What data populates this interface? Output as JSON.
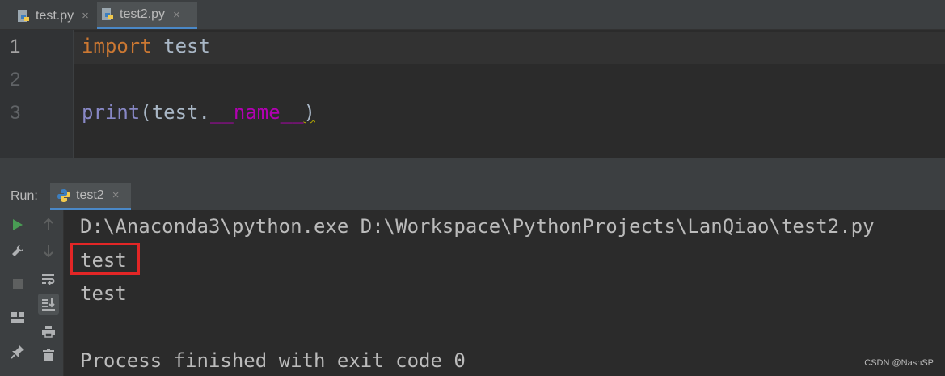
{
  "editor_tabs": [
    {
      "label": "test.py",
      "icon": "python-file-icon",
      "close": "×"
    },
    {
      "label": "test2.py",
      "icon": "python-file-icon",
      "close": "×",
      "active": true
    }
  ],
  "editor": {
    "line_numbers": [
      "1",
      "2",
      "3"
    ],
    "line1": {
      "keyword": "import",
      "text": " test"
    },
    "line3": {
      "func": "print",
      "open": "(test.",
      "attr": "__name__",
      "close": ")"
    }
  },
  "run_panel": {
    "label": "Run:",
    "tab_label": "test2",
    "tab_close": "×"
  },
  "console": {
    "command": "D:\\Anaconda3\\python.exe D:\\Workspace\\PythonProjects\\LanQiao\\test2.py",
    "output": [
      "test",
      "test"
    ],
    "exit_message": "Process finished with exit code 0"
  },
  "watermark": "CSDN @NashSP",
  "colors": {
    "background": "#2b2b2b",
    "keyword": "#cc7832",
    "builtin": "#8888c6",
    "magic": "#b200b2",
    "run_green": "#499c54",
    "highlight_box": "#e32626"
  }
}
